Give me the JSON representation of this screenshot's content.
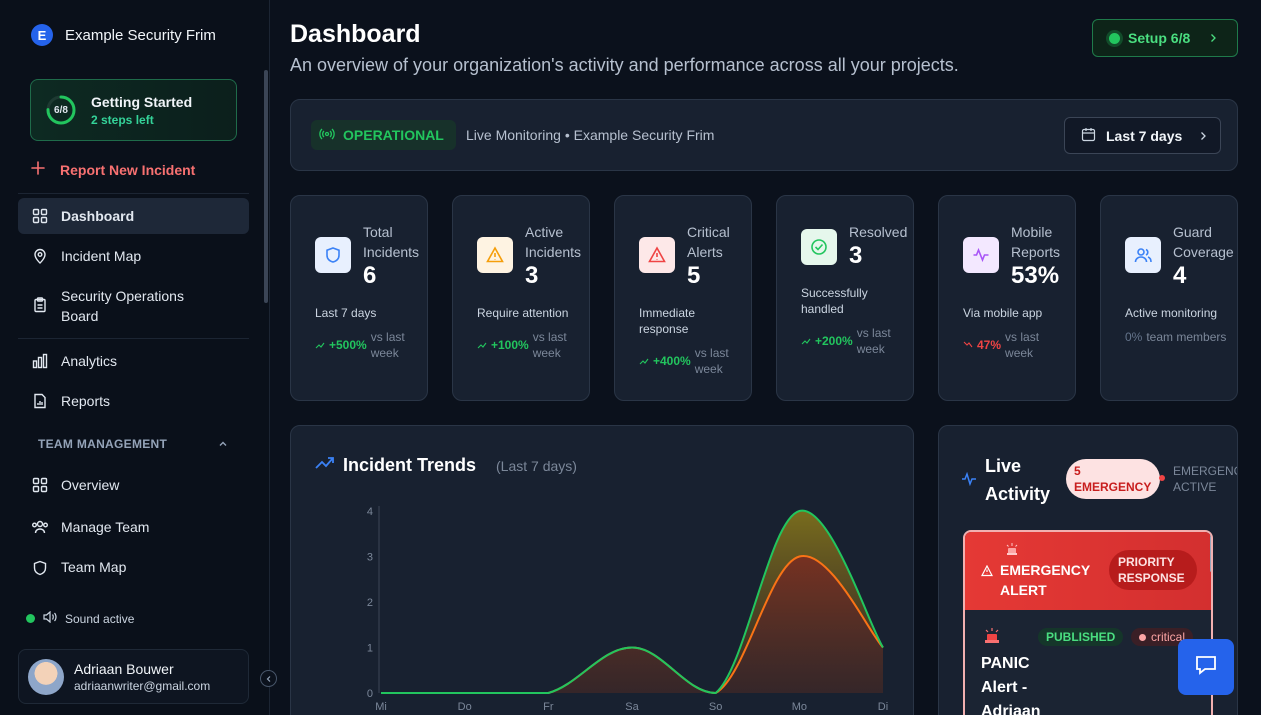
{
  "brand": {
    "initial": "E",
    "name": "Example Security Frim"
  },
  "getting_started": {
    "progress_text": "6/8",
    "progress": 0.75,
    "title": "Getting Started",
    "subtitle": "2 steps left"
  },
  "report_link": "Report New Incident",
  "nav": {
    "dashboard": "Dashboard",
    "incident_map": "Incident Map",
    "security_ops": "Security Operations Board",
    "analytics": "Analytics",
    "reports": "Reports",
    "team_section": "TEAM MANAGEMENT",
    "overview": "Overview",
    "manage_team": "Manage Team",
    "team_map": "Team Map"
  },
  "sound": "Sound active",
  "user": {
    "name": "Adriaan Bouwer",
    "email": "adriaanwriter@gmail.com"
  },
  "header": {
    "title": "Dashboard",
    "subtitle": "An overview of your organization's activity and performance across all your projects.",
    "setup": "Setup 6/8"
  },
  "status": {
    "state": "OPERATIONAL",
    "live_text": "Live Monitoring • Example Security Frim",
    "range": "Last 7 days"
  },
  "stats": [
    {
      "label": "Total Incidents",
      "value": "6",
      "desc": "Last 7 days",
      "trend": "+500%",
      "compare": "vs last week",
      "color": "#3b82f6"
    },
    {
      "label": "Active Incidents",
      "value": "3",
      "desc": "Require attention",
      "trend": "+100%",
      "compare": "vs last week",
      "color": "#f59e0b"
    },
    {
      "label": "Critical Alerts",
      "value": "5",
      "desc": "Immediate response",
      "trend": "+400%",
      "compare": "vs last week",
      "color": "#ef4444"
    },
    {
      "label": "Resolved",
      "value": "3",
      "desc": "Successfully handled",
      "trend": "+200%",
      "compare": "vs last week",
      "color": "#22c55e"
    },
    {
      "label": "Mobile Reports",
      "value": "53%",
      "desc": "Via mobile app",
      "trend": "47%",
      "compare": "vs last week",
      "color": "#a855f7"
    },
    {
      "label": "Guard Coverage",
      "value": "4",
      "desc": "Active monitoring",
      "trend": "0%",
      "compare": "team members",
      "color": "#3b82f6"
    }
  ],
  "trends": {
    "title": "Incident Trends",
    "subtitle": "(Last 7 days)"
  },
  "chart_data": {
    "type": "area",
    "categories": [
      "Mi",
      "Do",
      "Fr",
      "Sa",
      "So",
      "Mo",
      "Di"
    ],
    "series": [
      {
        "values": [
          0,
          0,
          0,
          1,
          0,
          4,
          1
        ],
        "color": "#22c55e"
      },
      {
        "values": [
          0,
          0,
          0,
          1,
          0,
          3,
          1
        ],
        "color": "#f97316"
      }
    ],
    "ylim": [
      0,
      4
    ],
    "yticks": [
      0,
      1,
      2,
      3,
      4
    ]
  },
  "live": {
    "title": "Live Activity",
    "emergency_pill": "5 EMERGENCY",
    "emergency_status": "EMERGENCY ACTIVE",
    "alert_title": "EMERGENCY ALERT",
    "priority": "PRIORITY RESPONSE",
    "published": "PUBLISHED",
    "severity": "critical",
    "body": "PANIC Alert - Adriaan"
  }
}
